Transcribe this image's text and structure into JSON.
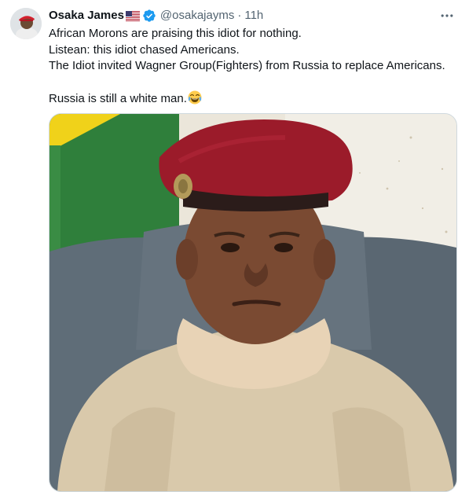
{
  "tweet": {
    "author": {
      "display_name": "Osaka James",
      "flag_icon": "us-flag-icon",
      "verified_icon": "verified-badge-icon",
      "handle": "@osakajayms",
      "separator": "·",
      "time": "11h"
    },
    "more_icon": "more-options-icon",
    "lines": [
      "African Morons are praising this idiot for nothing.",
      "Listean: this idiot chased Americans.",
      "The Idiot invited Wagner Group(Fighters) from Russia to replace Americans.",
      "",
      "Russia is still a white man."
    ],
    "emoji_icon": "face-with-tears-of-joy-icon"
  },
  "colors": {
    "text": "#0f1419",
    "secondary_text": "#536471",
    "verified": "#1d9bf0",
    "border": "#cfd9de",
    "beret": "#9b1b2a"
  }
}
